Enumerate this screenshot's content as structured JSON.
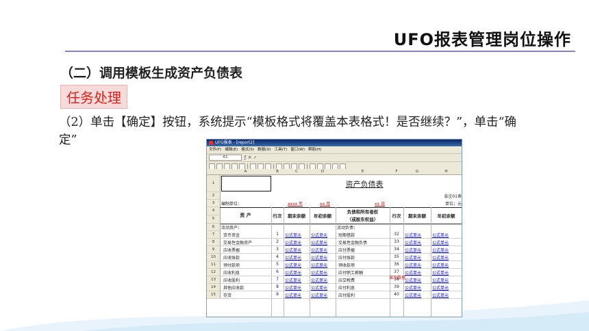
{
  "slide": {
    "title": "UFO报表管理岗位操作",
    "section_heading": "（二）调用模板生成资产负债表",
    "task_badge": "任务处理",
    "instruction": "（2）单击【确定】按钮，系统提示“模板格式将覆盖本表格式！是否继续？”，单击“确定”"
  },
  "app": {
    "window_title": "UFO报表 - [report2]",
    "menu": [
      "文件(F)",
      "编辑(E)",
      "格式(S)",
      "数据(D)",
      "工具(T)",
      "窗口(W)",
      "帮助(H)"
    ],
    "cell_ref": "A1",
    "columns": [
      "A",
      "B",
      "C",
      "D",
      "E",
      "F",
      "G",
      "H"
    ],
    "sheet": {
      "title": "资产负债表",
      "form_code": "会企01表",
      "unit_left": "编制单位：",
      "date_year": "xxxx 年",
      "date_month": "xx 月",
      "date_day": "xx 日",
      "unit_right": "单位：元",
      "header_asset": "资    产",
      "header_row": "行次",
      "header_end": "期末余额",
      "header_begin": "年初余额",
      "header_liab_1": "负债和所有者权",
      "header_liab_2": "（或股东权益）",
      "current_assets": "流动资产：",
      "current_liabs": "流动负债：",
      "demo_mark": "演示数据",
      "formula": "公式单元",
      "rows": [
        {
          "n": "7",
          "asset": "货币资金",
          "ai": "1",
          "liab": "短期借款",
          "li": "32"
        },
        {
          "n": "8",
          "asset": "交易性金融资产",
          "ai": "2",
          "liab": "交易性金融负债",
          "li": "33"
        },
        {
          "n": "9",
          "asset": "应收票据",
          "ai": "3",
          "liab": "应付票据",
          "li": "34"
        },
        {
          "n": "10",
          "asset": "应收账款",
          "ai": "4",
          "liab": "应付账款",
          "li": "35"
        },
        {
          "n": "11",
          "asset": "预付款项",
          "ai": "5",
          "liab": "预收款项",
          "li": "36"
        },
        {
          "n": "12",
          "asset": "应收利息",
          "ai": "6",
          "liab": "应付职工薪酬",
          "li": "37"
        },
        {
          "n": "13",
          "asset": "应收股利",
          "ai": "7",
          "liab": "应交税费",
          "li": "38"
        },
        {
          "n": "14",
          "asset": "其他应收款",
          "ai": "8",
          "liab": "应付利息",
          "li": "39"
        },
        {
          "n": "15",
          "asset": "存货",
          "ai": "9",
          "liab": "应付股利",
          "li": "40"
        }
      ]
    }
  }
}
